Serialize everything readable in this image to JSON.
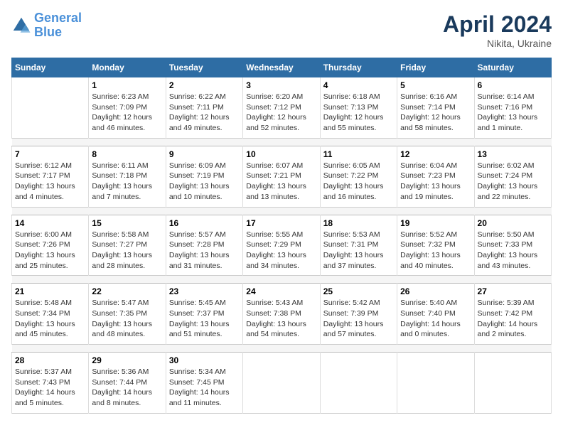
{
  "header": {
    "logo_line1": "General",
    "logo_line2": "Blue",
    "title": "April 2024",
    "subtitle": "Nikita, Ukraine"
  },
  "days_of_week": [
    "Sunday",
    "Monday",
    "Tuesday",
    "Wednesday",
    "Thursday",
    "Friday",
    "Saturday"
  ],
  "weeks": [
    {
      "days": [
        {
          "num": "",
          "info": ""
        },
        {
          "num": "1",
          "info": "Sunrise: 6:23 AM\nSunset: 7:09 PM\nDaylight: 12 hours\nand 46 minutes."
        },
        {
          "num": "2",
          "info": "Sunrise: 6:22 AM\nSunset: 7:11 PM\nDaylight: 12 hours\nand 49 minutes."
        },
        {
          "num": "3",
          "info": "Sunrise: 6:20 AM\nSunset: 7:12 PM\nDaylight: 12 hours\nand 52 minutes."
        },
        {
          "num": "4",
          "info": "Sunrise: 6:18 AM\nSunset: 7:13 PM\nDaylight: 12 hours\nand 55 minutes."
        },
        {
          "num": "5",
          "info": "Sunrise: 6:16 AM\nSunset: 7:14 PM\nDaylight: 12 hours\nand 58 minutes."
        },
        {
          "num": "6",
          "info": "Sunrise: 6:14 AM\nSunset: 7:16 PM\nDaylight: 13 hours\nand 1 minute."
        }
      ]
    },
    {
      "days": [
        {
          "num": "7",
          "info": "Sunrise: 6:12 AM\nSunset: 7:17 PM\nDaylight: 13 hours\nand 4 minutes."
        },
        {
          "num": "8",
          "info": "Sunrise: 6:11 AM\nSunset: 7:18 PM\nDaylight: 13 hours\nand 7 minutes."
        },
        {
          "num": "9",
          "info": "Sunrise: 6:09 AM\nSunset: 7:19 PM\nDaylight: 13 hours\nand 10 minutes."
        },
        {
          "num": "10",
          "info": "Sunrise: 6:07 AM\nSunset: 7:21 PM\nDaylight: 13 hours\nand 13 minutes."
        },
        {
          "num": "11",
          "info": "Sunrise: 6:05 AM\nSunset: 7:22 PM\nDaylight: 13 hours\nand 16 minutes."
        },
        {
          "num": "12",
          "info": "Sunrise: 6:04 AM\nSunset: 7:23 PM\nDaylight: 13 hours\nand 19 minutes."
        },
        {
          "num": "13",
          "info": "Sunrise: 6:02 AM\nSunset: 7:24 PM\nDaylight: 13 hours\nand 22 minutes."
        }
      ]
    },
    {
      "days": [
        {
          "num": "14",
          "info": "Sunrise: 6:00 AM\nSunset: 7:26 PM\nDaylight: 13 hours\nand 25 minutes."
        },
        {
          "num": "15",
          "info": "Sunrise: 5:58 AM\nSunset: 7:27 PM\nDaylight: 13 hours\nand 28 minutes."
        },
        {
          "num": "16",
          "info": "Sunrise: 5:57 AM\nSunset: 7:28 PM\nDaylight: 13 hours\nand 31 minutes."
        },
        {
          "num": "17",
          "info": "Sunrise: 5:55 AM\nSunset: 7:29 PM\nDaylight: 13 hours\nand 34 minutes."
        },
        {
          "num": "18",
          "info": "Sunrise: 5:53 AM\nSunset: 7:31 PM\nDaylight: 13 hours\nand 37 minutes."
        },
        {
          "num": "19",
          "info": "Sunrise: 5:52 AM\nSunset: 7:32 PM\nDaylight: 13 hours\nand 40 minutes."
        },
        {
          "num": "20",
          "info": "Sunrise: 5:50 AM\nSunset: 7:33 PM\nDaylight: 13 hours\nand 43 minutes."
        }
      ]
    },
    {
      "days": [
        {
          "num": "21",
          "info": "Sunrise: 5:48 AM\nSunset: 7:34 PM\nDaylight: 13 hours\nand 45 minutes."
        },
        {
          "num": "22",
          "info": "Sunrise: 5:47 AM\nSunset: 7:35 PM\nDaylight: 13 hours\nand 48 minutes."
        },
        {
          "num": "23",
          "info": "Sunrise: 5:45 AM\nSunset: 7:37 PM\nDaylight: 13 hours\nand 51 minutes."
        },
        {
          "num": "24",
          "info": "Sunrise: 5:43 AM\nSunset: 7:38 PM\nDaylight: 13 hours\nand 54 minutes."
        },
        {
          "num": "25",
          "info": "Sunrise: 5:42 AM\nSunset: 7:39 PM\nDaylight: 13 hours\nand 57 minutes."
        },
        {
          "num": "26",
          "info": "Sunrise: 5:40 AM\nSunset: 7:40 PM\nDaylight: 14 hours\nand 0 minutes."
        },
        {
          "num": "27",
          "info": "Sunrise: 5:39 AM\nSunset: 7:42 PM\nDaylight: 14 hours\nand 2 minutes."
        }
      ]
    },
    {
      "days": [
        {
          "num": "28",
          "info": "Sunrise: 5:37 AM\nSunset: 7:43 PM\nDaylight: 14 hours\nand 5 minutes."
        },
        {
          "num": "29",
          "info": "Sunrise: 5:36 AM\nSunset: 7:44 PM\nDaylight: 14 hours\nand 8 minutes."
        },
        {
          "num": "30",
          "info": "Sunrise: 5:34 AM\nSunset: 7:45 PM\nDaylight: 14 hours\nand 11 minutes."
        },
        {
          "num": "",
          "info": ""
        },
        {
          "num": "",
          "info": ""
        },
        {
          "num": "",
          "info": ""
        },
        {
          "num": "",
          "info": ""
        }
      ]
    }
  ]
}
